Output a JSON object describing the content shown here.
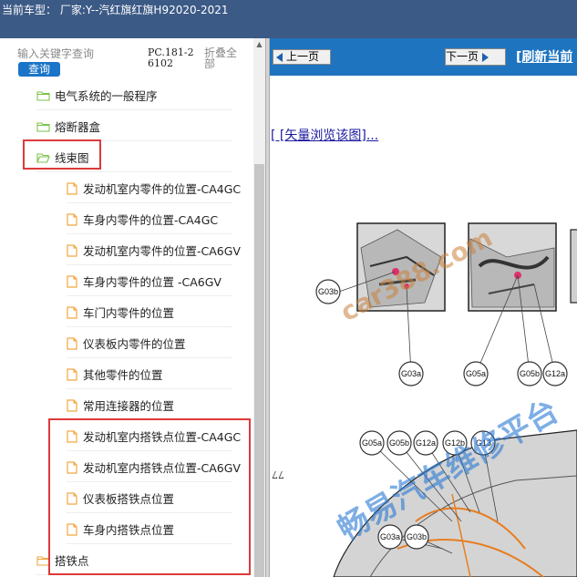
{
  "title_bar": {
    "text": "当前车型：  厂家:Y--汽红旗红旗H92020-2021"
  },
  "search": {
    "placeholder": "输入关键字查询",
    "query_label": "查询",
    "code": "PC.181-26102",
    "collapse_label": "折叠全部"
  },
  "tree": {
    "items": [
      {
        "label": "电气系统的一般程序",
        "type": "folder"
      },
      {
        "label": "熔断器盒",
        "type": "folder"
      },
      {
        "label": "线束图",
        "type": "folder-open"
      },
      {
        "label": "发动机室内零件的位置-CA4GC",
        "type": "doc"
      },
      {
        "label": "车身内零件的位置-CA4GC",
        "type": "doc"
      },
      {
        "label": "发动机室内零件的位置-CA6GV",
        "type": "doc"
      },
      {
        "label": "车身内零件的位置 -CA6GV",
        "type": "doc"
      },
      {
        "label": "车门内零件的位置",
        "type": "doc"
      },
      {
        "label": "仪表板内零件的位置",
        "type": "doc"
      },
      {
        "label": "其他零件的位置",
        "type": "doc"
      },
      {
        "label": "常用连接器的位置",
        "type": "doc"
      },
      {
        "label": "发动机室内搭铁点位置-CA4GC",
        "type": "doc"
      },
      {
        "label": "发动机室内搭铁点位置-CA6GV",
        "type": "doc"
      },
      {
        "label": "仪表板搭铁点位置",
        "type": "doc"
      },
      {
        "label": "车身内搭铁点位置",
        "type": "doc"
      },
      {
        "label": "搭铁点",
        "type": "folder"
      }
    ]
  },
  "viewer": {
    "prev_label": "上一页",
    "next_label": "下一页",
    "refresh_label": "[刷新当前",
    "vector_link": "[ [矢量浏览该图]...",
    "page_number": "77",
    "callouts": [
      "G03b",
      "G03a",
      "G05a",
      "G05b",
      "G12a",
      "G05a",
      "G05b",
      "G12a",
      "G12b",
      "G13",
      "G03a",
      "G03b"
    ],
    "watermark_1": "car388.com",
    "watermark_2": "畅易汽车维修平台"
  },
  "colors": {
    "title_bar": "#3c5a86",
    "nav_strip": "#1f74bf",
    "query_button": "#1a74c7",
    "highlight": "#dd3a3a",
    "folder": "#7cc24a",
    "doc": "#f2a640",
    "link": "#1a1aa0"
  }
}
